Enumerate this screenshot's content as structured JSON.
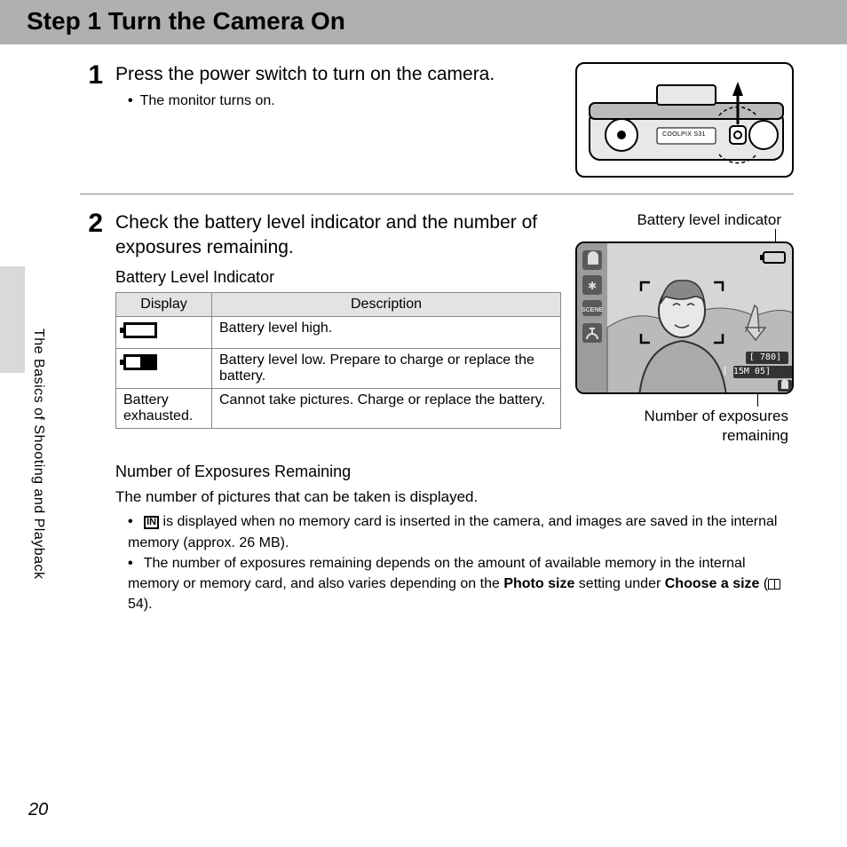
{
  "header": {
    "title": "Step 1 Turn the Camera On"
  },
  "sidebar": {
    "section_label": "The Basics of Shooting and Playback"
  },
  "page_number": "20",
  "step1": {
    "num": "1",
    "title": "Press the power switch to turn on the camera.",
    "bullet1": "The monitor turns on.",
    "camera_model": "COOLPIX S31"
  },
  "step2": {
    "num": "2",
    "title": "Check the battery level indicator and the number of exposures remaining.",
    "battery_heading": "Battery Level Indicator",
    "callout_top": "Battery level indicator",
    "callout_bottom_l1": "Number of exposures",
    "callout_bottom_l2": "remaining",
    "lcd": {
      "count": "780",
      "mode": "15M",
      "sec": "05"
    },
    "table": {
      "h1": "Display",
      "h2": "Description",
      "r1_desc": "Battery level high.",
      "r2_desc": "Battery level low. Prepare to charge or replace the battery.",
      "r3_disp": "Battery exhausted.",
      "r3_desc": "Cannot take pictures. Charge or replace the battery."
    },
    "exposures": {
      "heading": "Number of Exposures Remaining",
      "intro": "The number of pictures that can be taken is displayed.",
      "b1_a": " is displayed when no memory card is inserted in the camera, and images are saved in the internal memory (approx. 26 MB).",
      "b2_a": "The number of exposures remaining depends on the amount of available memory in the internal memory or memory card, and also varies depending on the ",
      "b2_bold1": "Photo size",
      "b2_mid": " setting under ",
      "b2_bold2": "Choose a size",
      "b2_end": " 54).",
      "open_paren": " ("
    }
  }
}
